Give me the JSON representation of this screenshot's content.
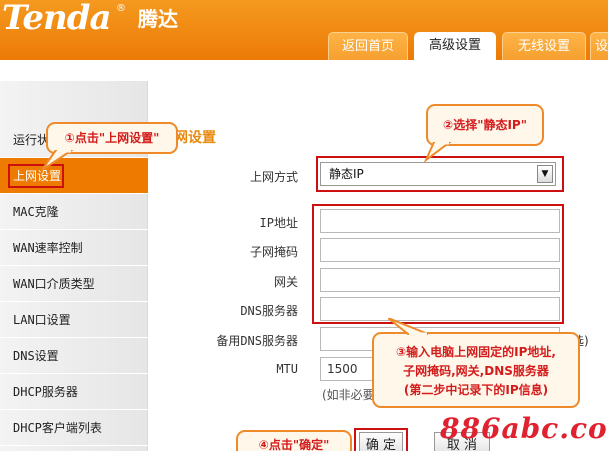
{
  "brand": {
    "logo_text": "Tenda",
    "reg_mark": "®",
    "cn_name": "腾达"
  },
  "tabs": [
    {
      "label": "返回首页"
    },
    {
      "label": "高级设置"
    },
    {
      "label": "无线设置"
    },
    {
      "label": "设"
    }
  ],
  "sidebar": {
    "items": [
      {
        "label": "运行状态"
      },
      {
        "label": "上网设置"
      },
      {
        "label": "MAC克隆"
      },
      {
        "label": "WAN速率控制"
      },
      {
        "label": "WAN口介质类型"
      },
      {
        "label": "LAN口设置"
      },
      {
        "label": "DNS设置"
      },
      {
        "label": "DHCP服务器"
      },
      {
        "label": "DHCP客户端列表"
      }
    ]
  },
  "main": {
    "title": "网设置",
    "connection_type_label": "上网方式",
    "connection_type_value": "静态IP",
    "ip_label": "IP地址",
    "mask_label": "子网掩码",
    "gateway_label": "网关",
    "dns_label": "DNS服务器",
    "dns2_label": "备用DNS服务器",
    "dns2_optional": "可选)",
    "mtu_label": "MTU",
    "mtu_value": "1500",
    "mtu_hint": "(如非必要"
  },
  "buttons": {
    "ok": "确 定",
    "cancel": "取 消"
  },
  "callouts": {
    "step1": "①点击\"上网设置\"",
    "step2": "②选择\"静态IP\"",
    "step3_line1": "③输入电脑上网固定的IP地址,",
    "step3_line2": "子网掩码,网关,DNS服务器",
    "step3_line3": "(第二步中记录下的IP信息)",
    "step4": "④点击\"确定\""
  },
  "watermark": "886abc.com",
  "colors": {
    "brand_orange": "#ee7b00",
    "highlight_red": "#cc1010",
    "callout_text": "#d41c1c"
  }
}
